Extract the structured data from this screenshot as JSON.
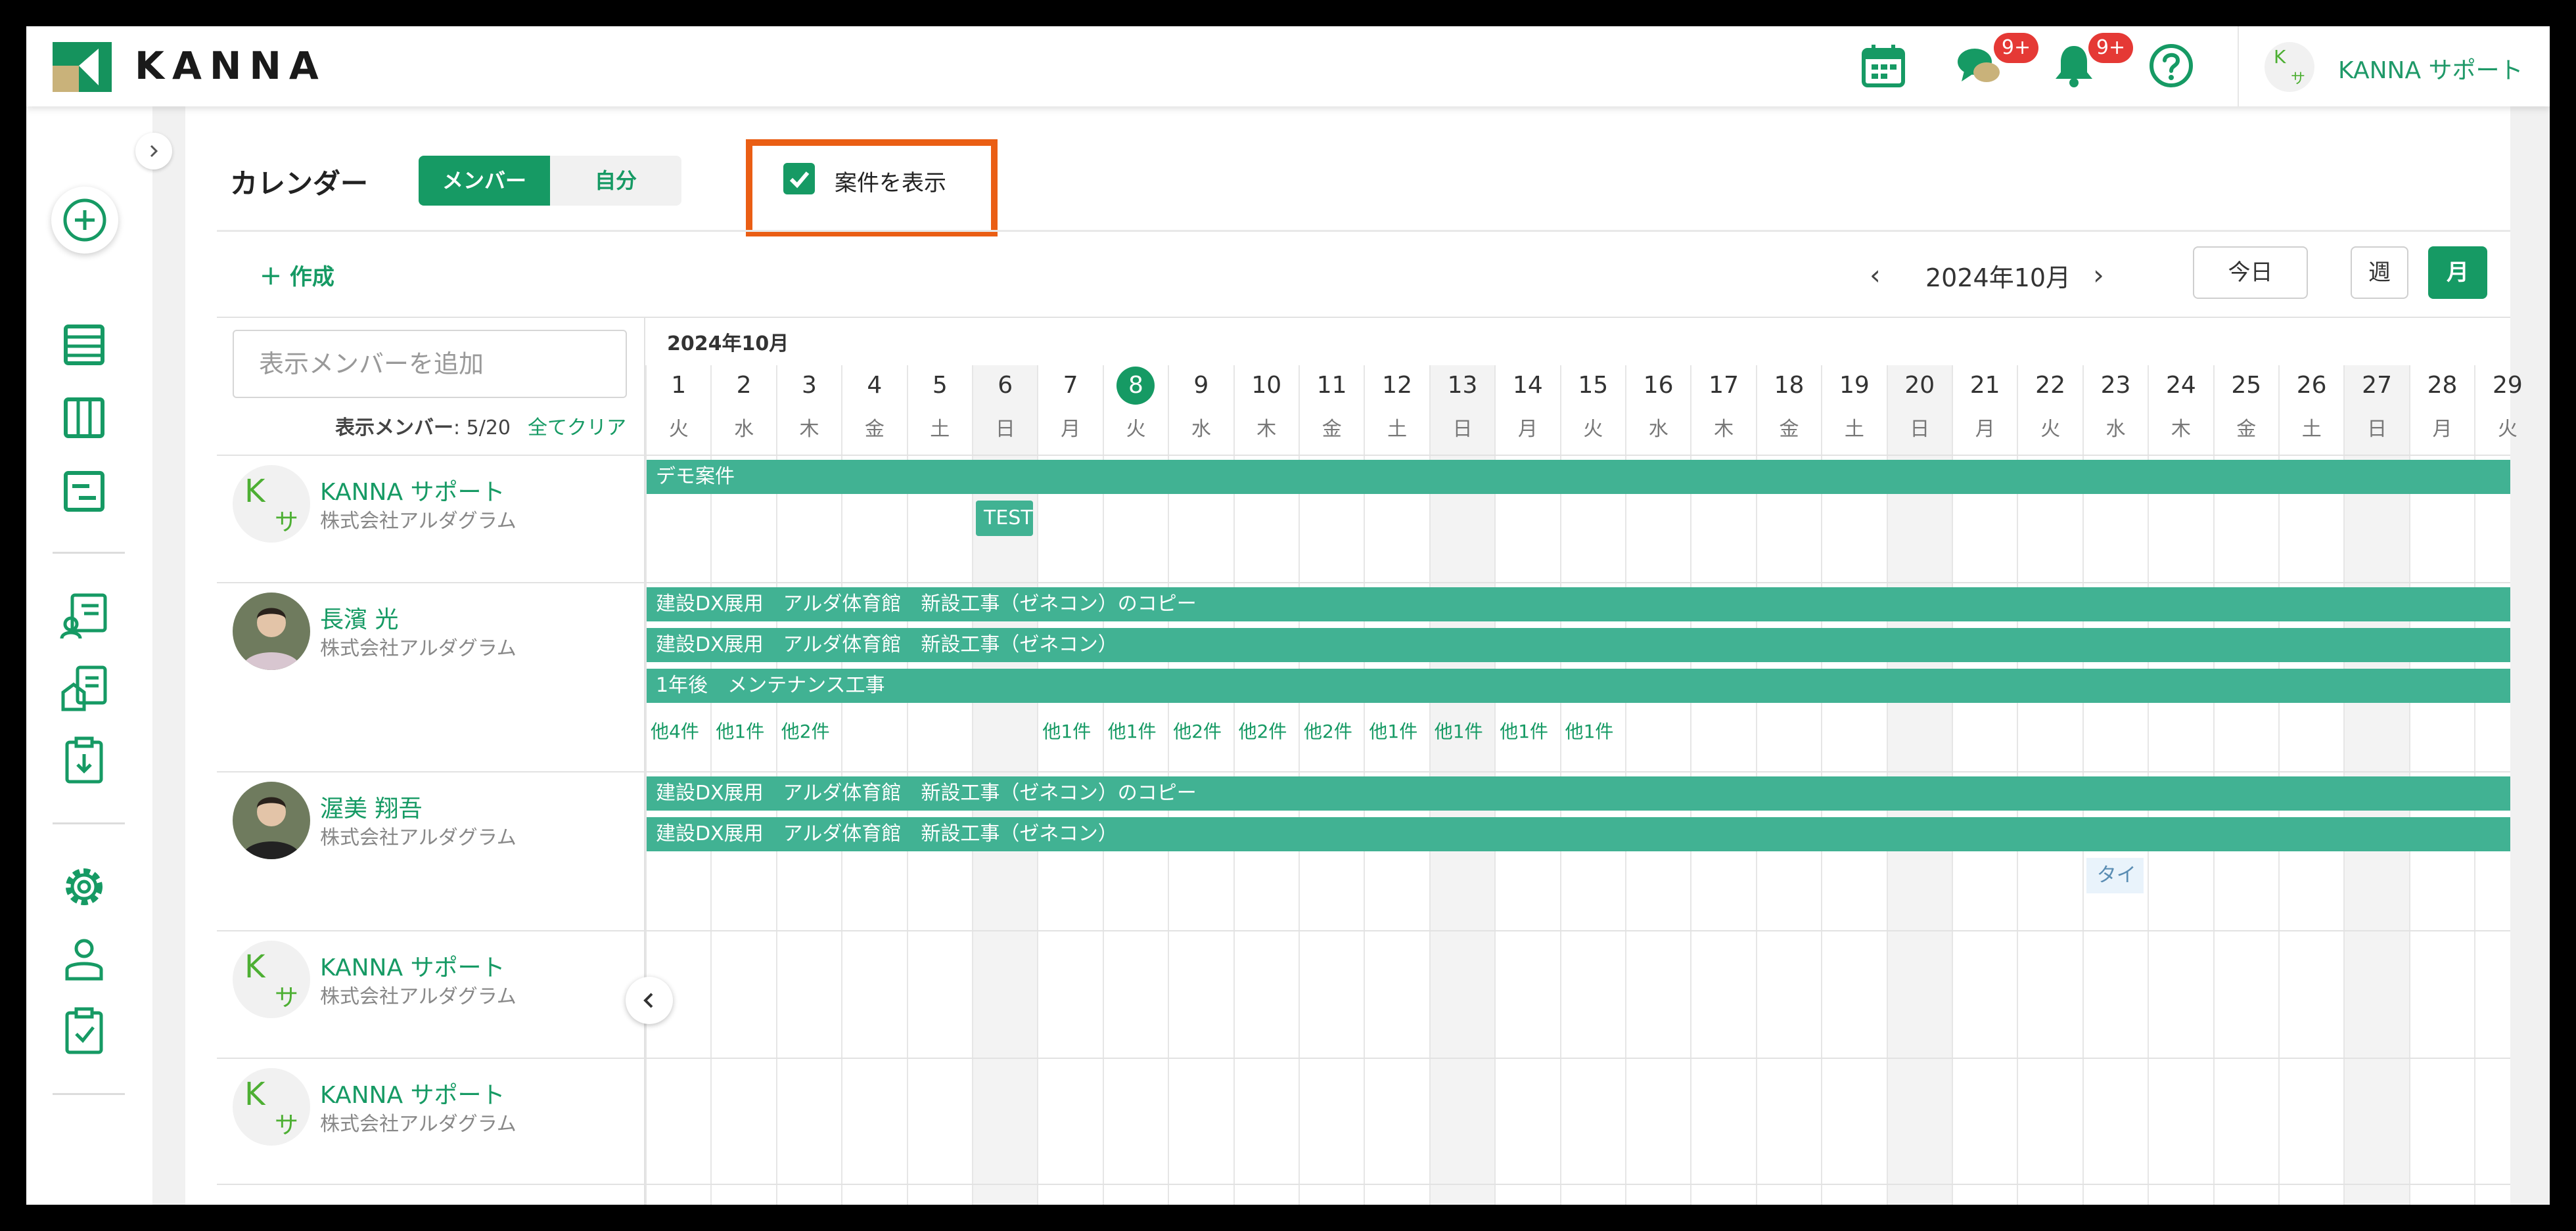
{
  "header": {
    "logo_text": "KANNA",
    "messages_badge": "9+",
    "notifications_badge": "9+",
    "user_name": "KANNA サポート",
    "avatar_k": "K",
    "avatar_sa": "サ",
    "icons": [
      "calendar-icon",
      "chat-icon",
      "bell-icon",
      "help-icon"
    ]
  },
  "toolbar": {
    "title": "カレンダー",
    "tab_member": "メンバー",
    "tab_self": "自分",
    "show_projects_label": "案件を表示",
    "show_projects_checked": true,
    "create_label": "作成",
    "month_label": "2024年10月",
    "today_label": "今日",
    "week_label": "週",
    "month_view_label": "月"
  },
  "members_panel": {
    "search_placeholder": "表示メンバーを追加",
    "count_label": "表示メンバー",
    "count_value": ": 5/20",
    "clear_all": "全てクリア"
  },
  "calendar": {
    "month_header": "2024年10月",
    "days": [
      {
        "d": "1",
        "w": "火"
      },
      {
        "d": "2",
        "w": "水"
      },
      {
        "d": "3",
        "w": "木"
      },
      {
        "d": "4",
        "w": "金"
      },
      {
        "d": "5",
        "w": "土"
      },
      {
        "d": "6",
        "w": "日"
      },
      {
        "d": "7",
        "w": "月"
      },
      {
        "d": "8",
        "w": "火"
      },
      {
        "d": "9",
        "w": "水"
      },
      {
        "d": "10",
        "w": "木"
      },
      {
        "d": "11",
        "w": "金"
      },
      {
        "d": "12",
        "w": "土"
      },
      {
        "d": "13",
        "w": "日"
      },
      {
        "d": "14",
        "w": "月"
      },
      {
        "d": "15",
        "w": "火"
      },
      {
        "d": "16",
        "w": "水"
      },
      {
        "d": "17",
        "w": "木"
      },
      {
        "d": "18",
        "w": "金"
      },
      {
        "d": "19",
        "w": "土"
      },
      {
        "d": "20",
        "w": "日"
      },
      {
        "d": "21",
        "w": "月"
      },
      {
        "d": "22",
        "w": "火"
      },
      {
        "d": "23",
        "w": "水"
      },
      {
        "d": "24",
        "w": "木"
      },
      {
        "d": "25",
        "w": "金"
      },
      {
        "d": "26",
        "w": "土"
      },
      {
        "d": "27",
        "w": "日"
      },
      {
        "d": "28",
        "w": "月"
      },
      {
        "d": "29",
        "w": "火"
      }
    ],
    "today": "8",
    "weekend_days": [
      "6",
      "13",
      "20",
      "27"
    ]
  },
  "members": [
    {
      "name": "KANNA サポート",
      "company": "株式会社アルダグラム",
      "avatar": "initials",
      "bars": [
        "デモ案件"
      ],
      "chips": [
        {
          "label": "TEST",
          "day": "6"
        }
      ]
    },
    {
      "name": "長濱 光",
      "company": "株式会社アルダグラム",
      "avatar": "photo",
      "bars": [
        "建設DX展用　アルダ体育館　新設工事（ゼネコン）のコピー",
        "建設DX展用　アルダ体育館　新設工事（ゼネコン）",
        "1年後　メンテナンス工事"
      ],
      "more": [
        {
          "day": "1",
          "label": "他4件"
        },
        {
          "day": "2",
          "label": "他1件"
        },
        {
          "day": "3",
          "label": "他2件"
        },
        {
          "day": "7",
          "label": "他1件"
        },
        {
          "day": "8",
          "label": "他1件"
        },
        {
          "day": "9",
          "label": "他2件"
        },
        {
          "day": "10",
          "label": "他2件"
        },
        {
          "day": "11",
          "label": "他2件"
        },
        {
          "day": "12",
          "label": "他1件"
        },
        {
          "day": "13",
          "label": "他1件"
        },
        {
          "day": "14",
          "label": "他1件"
        },
        {
          "day": "15",
          "label": "他1件"
        }
      ]
    },
    {
      "name": "渥美 翔吾",
      "company": "株式会社アルダグラム",
      "avatar": "photo",
      "bars": [
        "建設DX展用　アルダ体育館　新設工事（ゼネコン）のコピー",
        "建設DX展用　アルダ体育館　新設工事（ゼネコン）"
      ],
      "chips": [
        {
          "label": "タイト",
          "day": "23"
        }
      ]
    },
    {
      "name": "KANNA サポート",
      "company": "株式会社アルダグラム",
      "avatar": "initials"
    },
    {
      "name": "KANNA サポート",
      "company": "株式会社アルダグラム",
      "avatar": "initials"
    }
  ],
  "colors": {
    "brand_green": "#169a64",
    "bar_green": "#41b293",
    "highlight_orange": "#ea5e14",
    "badge_red": "#e53935"
  }
}
